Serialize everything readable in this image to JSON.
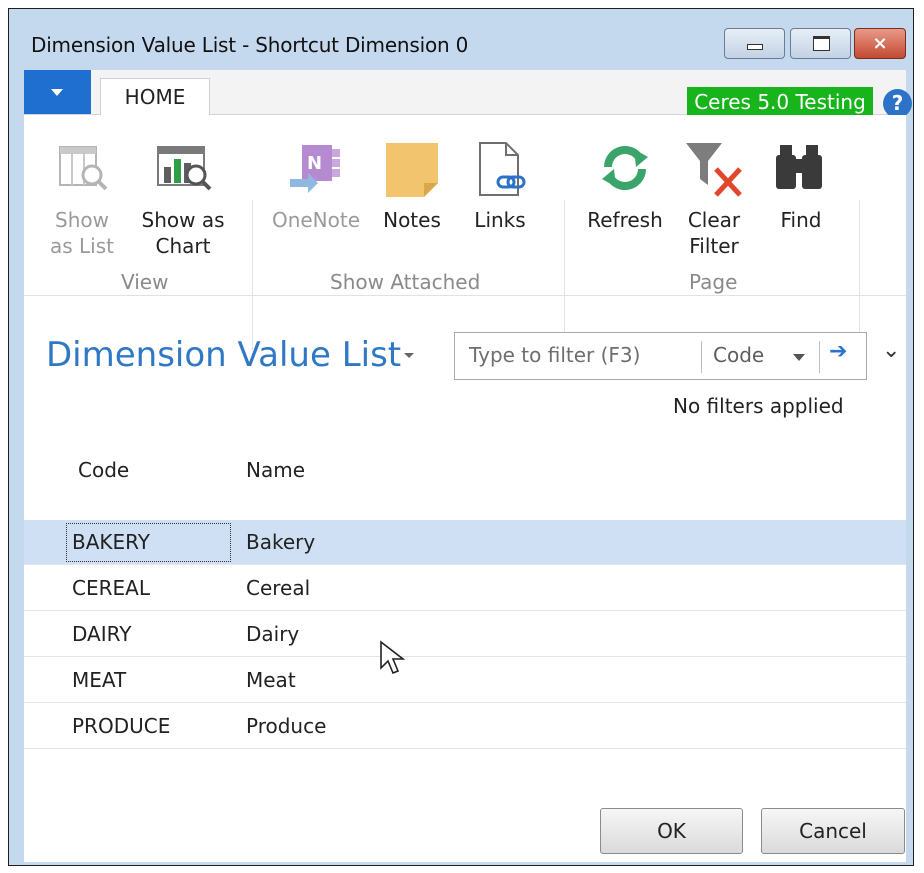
{
  "window": {
    "title": "Dimension Value List - Shortcut Dimension 0",
    "controls": {
      "minimize": "minimize",
      "maximize": "maximize",
      "close": "×"
    }
  },
  "tabs": {
    "home": "HOME"
  },
  "company": "Ceres 5.0 Testing",
  "help": "?",
  "ribbon": {
    "view": {
      "label": "View",
      "show_as_list": [
        "Show",
        "as List"
      ],
      "show_as_chart": [
        "Show as",
        "Chart"
      ]
    },
    "show_attached": {
      "label": "Show Attached",
      "onenote": "OneNote",
      "notes": "Notes",
      "links": "Links"
    },
    "page": {
      "label": "Page",
      "refresh": "Refresh",
      "clear_filter": [
        "Clear",
        "Filter"
      ],
      "find": "Find"
    }
  },
  "page": {
    "title": "Dimension Value List",
    "filter": {
      "placeholder": "Type to filter (F3)",
      "field": "Code",
      "status": "No filters applied"
    }
  },
  "table": {
    "columns": {
      "code": "Code",
      "name": "Name"
    },
    "rows": [
      {
        "code": "BAKERY",
        "name": "Bakery"
      },
      {
        "code": "CEREAL",
        "name": "Cereal"
      },
      {
        "code": "DAIRY",
        "name": "Dairy"
      },
      {
        "code": "MEAT",
        "name": "Meat"
      },
      {
        "code": "PRODUCE",
        "name": "Produce"
      }
    ],
    "selected_row": "BAKERY"
  },
  "buttons": {
    "ok": "OK",
    "cancel": "Cancel"
  },
  "colors": {
    "accent": "#2f78c4",
    "company_badge": "#17b41b",
    "selected_row": "#cfe0f4",
    "app_menu": "#1f6fd0"
  }
}
